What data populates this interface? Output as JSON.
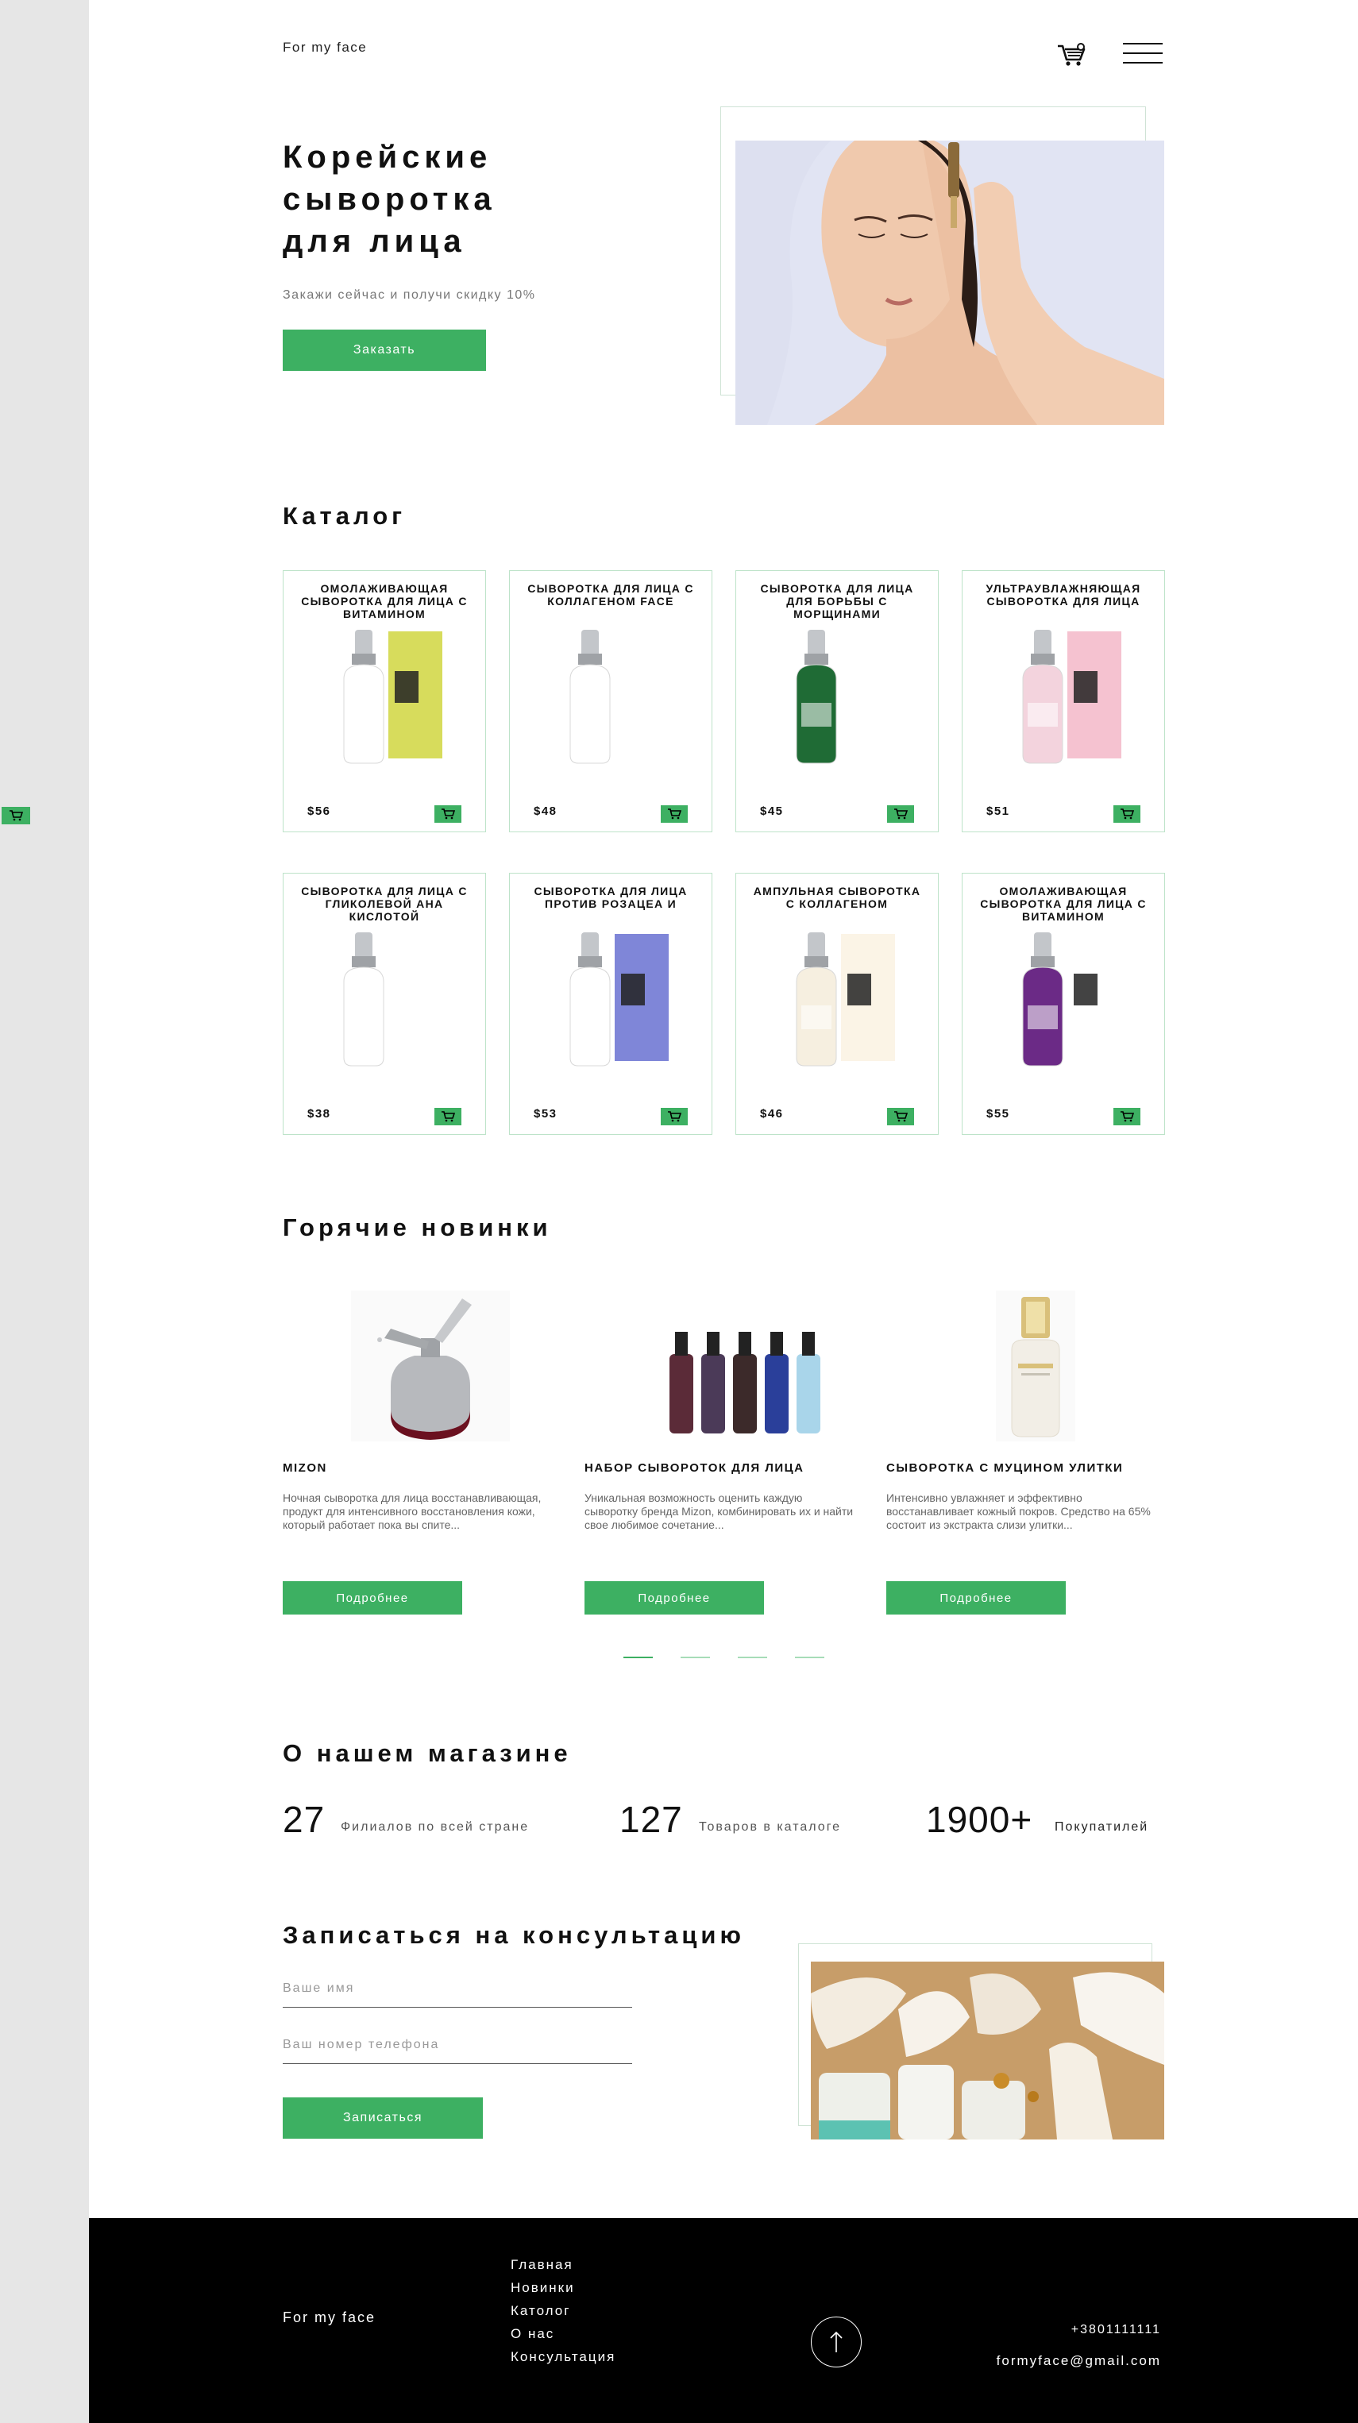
{
  "header": {
    "logo": "For my face",
    "cart_icon": "cart-icon",
    "menu_icon": "burger-menu-icon"
  },
  "hero": {
    "title_lines": [
      "Корейские",
      "сыворотка",
      "для лица"
    ],
    "subtitle": "Закажи сейчас и получи скидку 10%",
    "cta_label": "Заказать"
  },
  "catalog": {
    "title": "Каталог",
    "products": [
      {
        "name": "ОМОЛАЖИВАЮЩАЯ СЫВОРОТКА ДЛЯ ЛИЦА С ВИТАМИНОМ",
        "price": "$56",
        "bottle": "#ffffff",
        "box": "#d7dc5c"
      },
      {
        "name": "СЫВОРОТКА ДЛЯ ЛИЦА С КОЛЛАГЕНОМ FACE",
        "price": "$48",
        "bottle": "#ffffff",
        "box": ""
      },
      {
        "name": "СЫВОРОТКА ДЛЯ ЛИЦА ДЛЯ БОРЬБЫ С МОРЩИНАМИ",
        "price": "$45",
        "bottle": "#1f6b35",
        "box": ""
      },
      {
        "name": "УЛЬТРАУВЛАЖНЯЮЩАЯ СЫВОРОТКА ДЛЯ ЛИЦА",
        "price": "$51",
        "bottle": "#f3d3dd",
        "box": "#f5c2d0"
      },
      {
        "name": "СЫВОРОТКА ДЛЯ ЛИЦА С ГЛИКОЛЕВОЙ АНА КИСЛОТОЙ",
        "price": "$38",
        "bottle": "#ffffff",
        "box": ""
      },
      {
        "name": "СЫВОРОТКА ДЛЯ ЛИЦА ПРОТИВ РОЗАЦЕА И",
        "price": "$53",
        "bottle": "#ffffff",
        "box": "#7f86d8"
      },
      {
        "name": "АМПУЛЬНАЯ СЫВОРОТКА С КОЛЛАГЕНОМ",
        "price": "$46",
        "bottle": "#f6efe0",
        "box": "#fbf4e6"
      },
      {
        "name": "ОМОЛАЖИВАЮЩАЯ СЫВОРОТКА ДЛЯ ЛИЦА С ВИТАМИНОМ",
        "price": "$55",
        "bottle": "#6b2a86",
        "box": "#ffffff"
      }
    ]
  },
  "hot": {
    "title": "Горячие новинки",
    "items": [
      {
        "name": "MIZON",
        "desc": "Ночная сыворотка для лица восстанавливающая, продукт для интенсивного восстановления кожи, который работает пока вы спите...",
        "button": "Подробнее"
      },
      {
        "name": "НАБОР СЫВОРОТОК ДЛЯ ЛИЦА",
        "desc": "Уникальная возможность оценить каждую сыворотку бренда Mizon, комбинировать их и найти свое любимое сочетание...",
        "button": "Подробнее"
      },
      {
        "name": "СЫВОРОТКА С МУЦИНОМ УЛИТКИ",
        "desc": "Интенсивно увлажняет и эффективно восстанавливает кожный покров. Средство на 65% состоит из экстракта слизи улитки...",
        "button": "Подробнее"
      }
    ],
    "slider": {
      "count": 4,
      "active": 1
    }
  },
  "about": {
    "title": "О нашем магазине",
    "stats": [
      {
        "value": "27",
        "label": "Филиалов по всей стране"
      },
      {
        "value": "127",
        "label": "Товаров в каталоге"
      },
      {
        "value": "1900+",
        "label": "Покупатилей"
      }
    ]
  },
  "consult": {
    "title": "Записаться на консультацию",
    "name_placeholder": "Ваше имя",
    "phone_placeholder": "Ваш номер телефона",
    "button": "Записаться"
  },
  "footer": {
    "logo": "For my face",
    "nav": [
      "Главная",
      "Новинки",
      "Католог",
      "О нас",
      "Консультация"
    ],
    "phone": "+3801111111",
    "email": "formyface@gmail.com",
    "up_icon": "arrow-up-icon"
  },
  "colors": {
    "accent": "#3db062",
    "border": "#bde3c9",
    "rail": "#e6e6e6",
    "footer": "#000000"
  }
}
